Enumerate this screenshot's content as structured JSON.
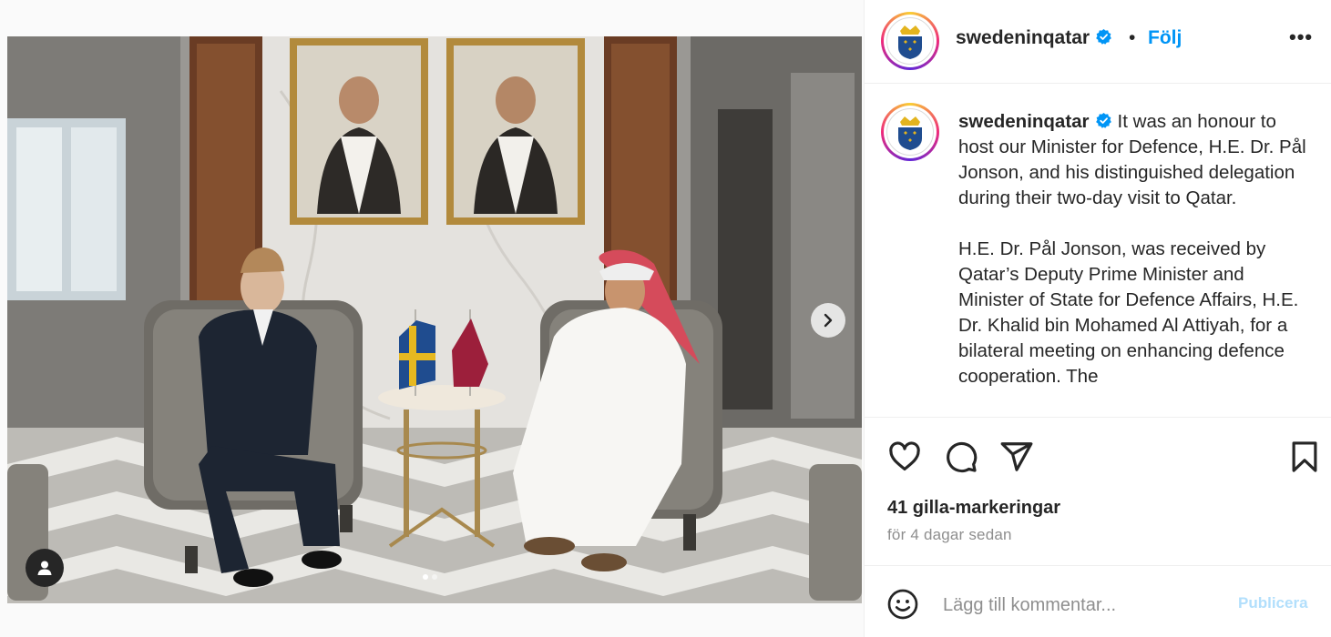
{
  "post": {
    "username": "swedeninqatar",
    "separator": "•",
    "follow_label": "Följ",
    "more_label": "•••",
    "caption_paragraphs": [
      "It was an honour to host our Minister for Defence, H.E. Dr. Pål Jonson, and his distinguished delegation during their two-day visit to Qatar.",
      "H.E. Dr. Pål Jonson, was received by Qatar’s Deputy Prime Minister and Minister of State for Defence Affairs, H.E. Dr. Khalid bin Mohamed Al Attiyah, for a bilateral meeting on enhancing defence cooperation. The"
    ],
    "likes_text": "41 gilla-markeringar",
    "time_ago": "för 4 dagar sedan",
    "comment_placeholder": "Lägg till kommentar...",
    "publish_label": "Publicera"
  },
  "carousel": {
    "slide_count": 2,
    "active_slide": 1
  },
  "icons": {
    "like": "heart-icon",
    "comment": "comment-icon",
    "share": "share-icon",
    "save": "bookmark-icon",
    "emoji": "emoji-icon",
    "next": "chevron-right-icon",
    "tags": "user-tag-icon",
    "verified": "verified-badge-icon"
  },
  "colors": {
    "link_blue": "#0095f6",
    "publish_disabled": "#b2dffc",
    "text": "#262626",
    "muted": "#8e8e8e"
  }
}
